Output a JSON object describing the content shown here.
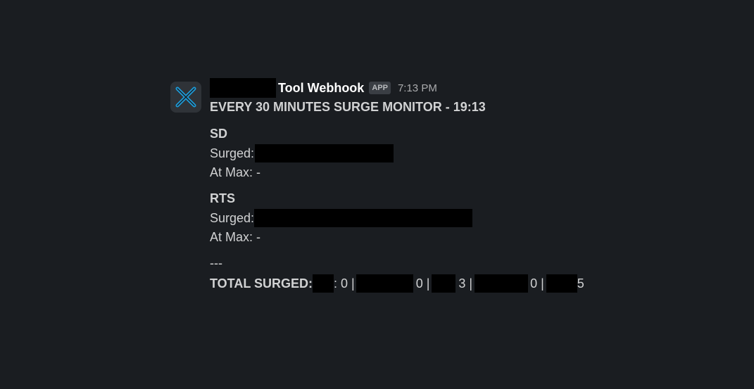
{
  "message": {
    "sender_name": "Tool Webhook",
    "app_badge": "APP",
    "timestamp": "7:13 PM",
    "title": "EVERY 30 MINUTES SURGE MONITOR - 19:13",
    "sections": [
      {
        "heading": "SD",
        "surged_label": "Surged:",
        "at_max_label": "At Max: -"
      },
      {
        "heading": "RTS",
        "surged_label": "Surged:",
        "at_max_label": "At Max: -"
      }
    ],
    "separator": "---",
    "total": {
      "label": "TOTAL SURGED:",
      "values": [
        ": 0 |",
        "0 |",
        "3 |",
        "0 |",
        "5"
      ]
    }
  },
  "colors": {
    "background": "#1a1d21",
    "text": "#d1d2d3",
    "sender": "#ffffff",
    "logo_accent": "#1d9bd8",
    "redaction": "#000000"
  },
  "icons": {
    "avatar": "x-logo-icon"
  }
}
